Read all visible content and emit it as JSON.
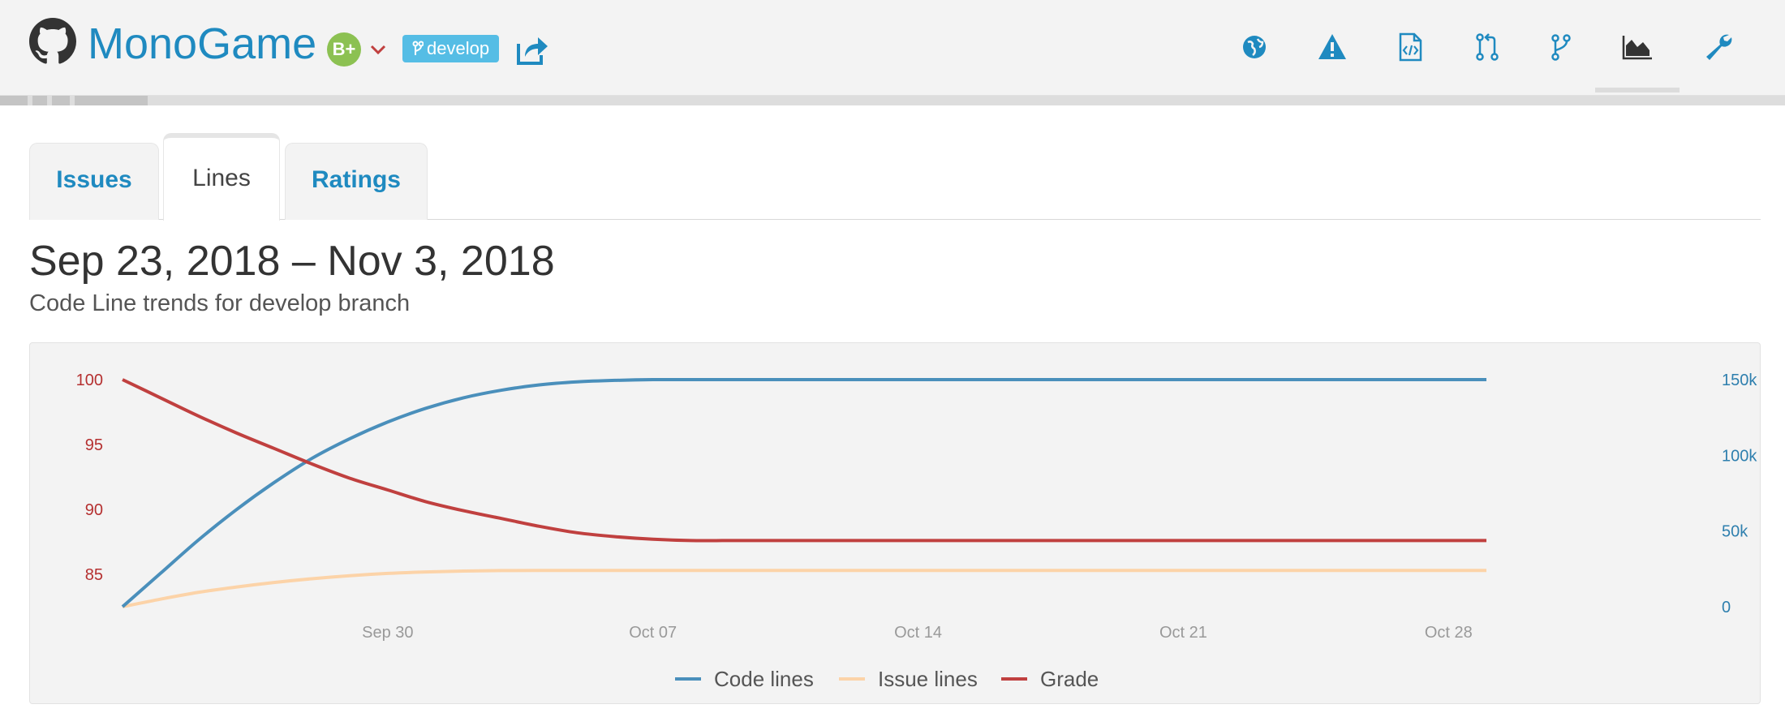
{
  "header": {
    "repo_name": "MonoGame",
    "grade": "B+",
    "branch": "develop",
    "nav_icons": [
      "globe-icon",
      "warning-icon",
      "code-file-icon",
      "pull-request-icon",
      "branch-icon",
      "area-chart-icon",
      "wrench-icon"
    ],
    "active_nav": "area-chart-icon"
  },
  "tabs": [
    {
      "label": "Issues",
      "active": false
    },
    {
      "label": "Lines",
      "active": true
    },
    {
      "label": "Ratings",
      "active": false
    }
  ],
  "page": {
    "date_range": "Sep 23, 2018 – Nov 3, 2018",
    "subtitle": "Code Line trends for develop branch"
  },
  "colors": {
    "code_lines": "#4a8fbb",
    "issue_lines": "#fcd3a8",
    "grade": "#c0403f",
    "link": "#1f8ac0"
  },
  "chart_data": {
    "type": "line",
    "x": [
      "2018-09-23",
      "2018-09-24",
      "2018-09-25",
      "2018-09-26",
      "2018-09-27",
      "2018-09-28",
      "2018-09-29",
      "2018-09-30",
      "2018-10-01",
      "2018-10-02",
      "2018-10-03",
      "2018-10-04",
      "2018-10-05",
      "2018-10-06",
      "2018-10-07",
      "2018-10-08",
      "2018-10-09",
      "2018-10-10",
      "2018-10-11",
      "2018-10-12",
      "2018-10-13",
      "2018-10-14",
      "2018-10-15",
      "2018-10-16",
      "2018-10-17",
      "2018-10-18",
      "2018-10-19",
      "2018-10-20",
      "2018-10-21",
      "2018-10-22",
      "2018-10-23",
      "2018-10-24",
      "2018-10-25",
      "2018-10-26",
      "2018-10-27",
      "2018-10-28",
      "2018-10-29"
    ],
    "x_ticks": [
      "Sep 30",
      "Oct 07",
      "Oct 14",
      "Oct 21",
      "Oct 28"
    ],
    "y_left": {
      "ticks": [
        "100",
        "95",
        "90",
        "85"
      ],
      "range": [
        82.5,
        100
      ]
    },
    "y_right": {
      "ticks": [
        "150k",
        "100k",
        "50k",
        "0"
      ],
      "range": [
        0,
        150000
      ]
    },
    "series": [
      {
        "name": "Code lines",
        "axis": "right",
        "values": [
          0,
          22000,
          44000,
          64000,
          82000,
          98000,
          111000,
          122000,
          131000,
          138000,
          143000,
          146500,
          148500,
          149500,
          150000,
          150000,
          150000,
          150000,
          150000,
          150000,
          150000,
          150000,
          150000,
          150000,
          150000,
          150000,
          150000,
          150000,
          150000,
          150000,
          150000,
          150000,
          150000,
          150000,
          150000,
          150000,
          150000
        ]
      },
      {
        "name": "Issue lines",
        "axis": "right",
        "values": [
          0,
          5000,
          9500,
          13000,
          16000,
          18500,
          20500,
          22000,
          23000,
          23600,
          23900,
          24000,
          24000,
          24000,
          24000,
          24000,
          24000,
          24000,
          24000,
          24000,
          24000,
          24000,
          24000,
          24000,
          24000,
          24000,
          24000,
          24000,
          24000,
          24000,
          24000,
          24000,
          24000,
          24000,
          24000,
          24000,
          24000
        ]
      },
      {
        "name": "Grade",
        "axis": "left",
        "values": [
          100,
          98.6,
          97.2,
          95.9,
          94.7,
          93.5,
          92.4,
          91.5,
          90.6,
          89.9,
          89.3,
          88.7,
          88.2,
          87.9,
          87.7,
          87.6,
          87.6,
          87.6,
          87.6,
          87.6,
          87.6,
          87.6,
          87.6,
          87.6,
          87.6,
          87.6,
          87.6,
          87.6,
          87.6,
          87.6,
          87.6,
          87.6,
          87.6,
          87.6,
          87.6,
          87.6,
          87.6
        ]
      }
    ],
    "legend": [
      "Code lines",
      "Issue lines",
      "Grade"
    ],
    "legend_position": "bottom-center",
    "grid": false
  }
}
